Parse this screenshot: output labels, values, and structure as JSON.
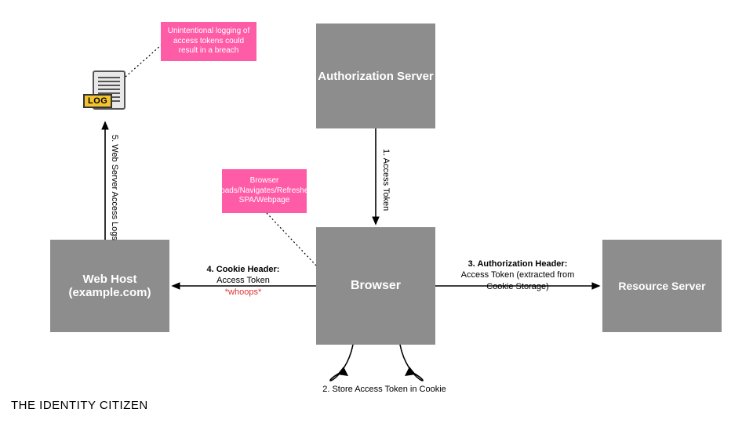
{
  "nodes": {
    "authServer": "Authorization Server",
    "browser": "Browser",
    "webHost": "Web Host (example.com)",
    "resourceServer": "Resource Server"
  },
  "notes": {
    "logging": "Unintentional logging of access tokens could result in a breach",
    "spa": "Browser Loads/Navigates/Refreshes SPA/Webpage"
  },
  "labels": {
    "step1": "1. Access Token",
    "step2": "2. Store Access Token in Cookie",
    "step3_title": "3. Authorization Header:",
    "step3_body": "Access Token (extracted from Cookie Storage)",
    "step4_title": "4. Cookie Header:",
    "step4_body": "Access Token",
    "step4_whoops": "*whoops*",
    "step5": "5. Web Server Access Logs"
  },
  "logIcon": {
    "tag": "LOG"
  },
  "footer": "THE IDENTITY CITIZEN"
}
